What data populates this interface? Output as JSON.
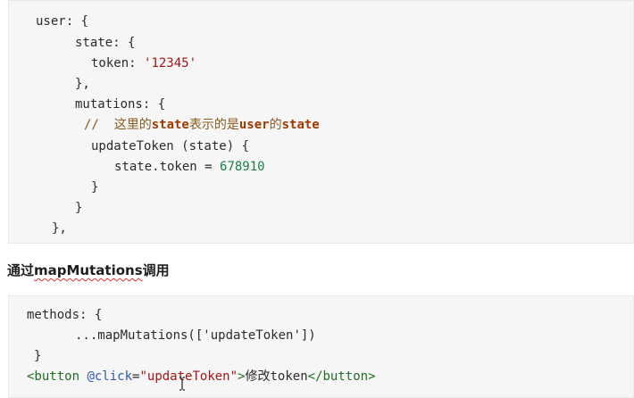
{
  "block1": {
    "l1": "user: {",
    "l2": "state: {",
    "l3_key": "token: ",
    "l3_val": "'12345'",
    "l4": "},",
    "l5": "mutations: {",
    "l6_slash": "//  ",
    "l6_a": "这里的",
    "l6_b": "state",
    "l6_c": "表示的是",
    "l6_d": "user",
    "l6_e": "的",
    "l6_f": "state",
    "l7": "updateToken (state) {",
    "l8_key": "state.token = ",
    "l8_val": "678910",
    "l9": "}",
    "l10": "}",
    "l11": "},"
  },
  "heading": {
    "prefix": "通过",
    "keyword": "mapMutations",
    "suffix": "调用"
  },
  "block2": {
    "l1": "methods: {",
    "l2_a": "...mapMutations([",
    "l2_b": "'updateToken'",
    "l2_c": "])",
    "l3": "}",
    "l4_open": "<button",
    "l4_attr": " @click",
    "l4_eq": "=",
    "l4_str": "\"updateToken\"",
    "l4_gt": ">",
    "l4_text": "修改token",
    "l4_close": "</button>"
  },
  "colors": {
    "code_bg": "#f6f6f7",
    "string": "#a31515",
    "number": "#1a7f4b",
    "comment": "#8a5a1e",
    "tag": "#1f6e1f",
    "attribute": "#2c58b5"
  },
  "icons": {
    "cursor": "text-cursor-icon"
  }
}
